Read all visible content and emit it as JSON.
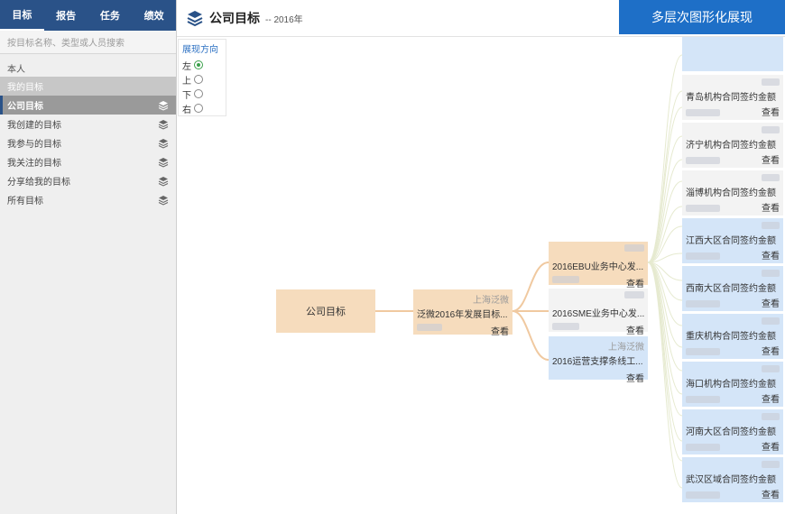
{
  "sidebar": {
    "tabs": [
      "目标",
      "报告",
      "任务",
      "绩效"
    ],
    "search_placeholder": "按目标名称、类型或人员搜索",
    "section": "本人",
    "items": [
      "我的目标",
      "公司目标",
      "我创建的目标",
      "我参与的目标",
      "我关注的目标",
      "分享给我的目标",
      "所有目标"
    ]
  },
  "header": {
    "title": "公司目标",
    "subtitle": "-- 2016年",
    "banner": "多层次图形化展现"
  },
  "direction": {
    "title": "展现方向",
    "options": [
      "左",
      "上",
      "下",
      "右"
    ],
    "selected": "左"
  },
  "tree": {
    "root": "公司目标",
    "level1": {
      "owner": "上海泛微",
      "name": "泛微2016年发展目标...",
      "action": "查看"
    },
    "level2": [
      {
        "owner": "",
        "name": "2016EBU业务中心发...",
        "action": "查看",
        "color": "peach"
      },
      {
        "owner": "",
        "name": "2016SME业务中心发...",
        "action": "查看",
        "color": "white"
      },
      {
        "owner": "上海泛微",
        "name": "2016运营支撑条线工...",
        "action": "查看",
        "color": "blue"
      }
    ],
    "level3": [
      {
        "name": "",
        "action": ""
      },
      {
        "name": "青岛机构合同签约金额",
        "action": "查看"
      },
      {
        "name": "济宁机构合同签约金额",
        "action": "查看"
      },
      {
        "name": "淄博机构合同签约金额",
        "action": "查看"
      },
      {
        "name": "江西大区合同签约金额",
        "action": "查看"
      },
      {
        "name": "西南大区合同签约金额",
        "action": "查看"
      },
      {
        "name": "重庆机构合同签约金额",
        "action": "查看"
      },
      {
        "name": "海口机构合同签约金额",
        "action": "查看"
      },
      {
        "name": "河南大区合同签约金额",
        "action": "查看"
      },
      {
        "name": "武汉区域合同签约金额",
        "action": "查看"
      }
    ]
  },
  "colors": {
    "tab_bg": "#2a5288",
    "banner_bg": "#1e6fc7",
    "peach": "#f6dcbd",
    "blue": "#d4e5f8",
    "link": "#f0c9a0"
  }
}
